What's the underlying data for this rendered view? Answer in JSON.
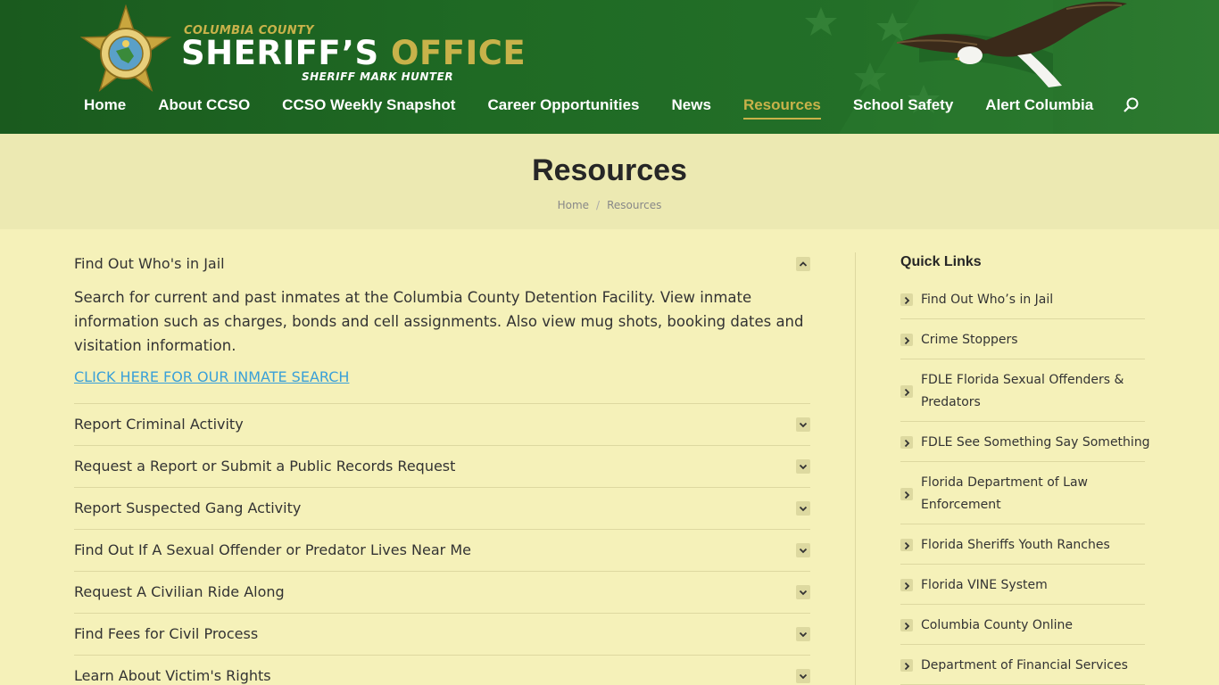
{
  "header": {
    "logo_small": "COLUMBIA COUNTY",
    "logo_big_white": "SHERIFF’S",
    "logo_big_gold": "OFFICE",
    "logo_sub": "SHERIFF MARK HUNTER",
    "colors": {
      "green": "#1f6a24",
      "gold": "#c8b24a"
    }
  },
  "nav": {
    "items": [
      {
        "label": "Home"
      },
      {
        "label": "About CCSO"
      },
      {
        "label": "CCSO Weekly Snapshot"
      },
      {
        "label": "Career Opportunities"
      },
      {
        "label": "News"
      },
      {
        "label": "Resources",
        "active": true
      },
      {
        "label": "School Safety"
      },
      {
        "label": "Alert Columbia"
      }
    ],
    "search_icon": "search-icon"
  },
  "page": {
    "title": "Resources",
    "breadcrumb": [
      "Home",
      "Resources"
    ]
  },
  "accordion": {
    "open_item": {
      "title": "Find Out Who's in Jail",
      "body": "Search for current and past inmates at the Columbia County Detention Facility. View inmate information such as charges, bonds and cell assignments. Also view mug shots, booking dates and visitation information.",
      "link": "CLICK HERE FOR OUR INMATE SEARCH"
    },
    "items": [
      "Report Criminal Activity",
      "Request a Report or Submit a Public Records Request",
      "Report Suspected Gang Activity",
      "Find Out If A Sexual Offender or Predator Lives Near Me",
      "Request A Civilian Ride Along",
      "Find Fees for Civil Process",
      "Learn About Victim's Rights"
    ]
  },
  "sidebar": {
    "title": "Quick Links",
    "links": [
      "Find Out Who’s in Jail",
      "Crime Stoppers",
      "FDLE Florida Sexual Offenders & Predators",
      "FDLE See Something Say Something",
      "Florida Department of Law Enforcement",
      "Florida Sheriffs Youth Ranches",
      "Florida VINE System",
      "Columbia County Online",
      "Department of Financial Services"
    ]
  }
}
